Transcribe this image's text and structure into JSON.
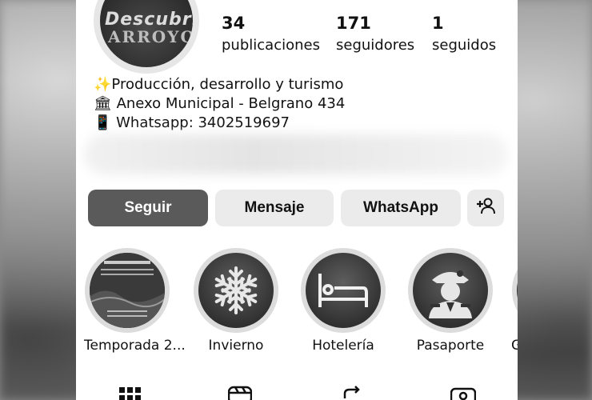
{
  "profile": {
    "avatar_text_1": "Descubrí",
    "avatar_text_2": "ARROYO"
  },
  "stats": [
    {
      "value": "34",
      "label": "publicaciones"
    },
    {
      "value": "171",
      "label": "seguidores"
    },
    {
      "value": "1",
      "label": "seguidos"
    }
  ],
  "bio": {
    "line1": "✨Producción, desarrollo y turismo",
    "line2": "🏛 Anexo Municipal - Belgrano 434",
    "line3": "📱 Whatsapp: 3402519697"
  },
  "actions": {
    "follow": "Seguir",
    "message": "Mensaje",
    "whatsapp": "WhatsApp"
  },
  "highlights": [
    {
      "label": "Temporada 2...",
      "icon": "poster-icon"
    },
    {
      "label": "Invierno",
      "icon": "snowflake-icon"
    },
    {
      "label": "Hotelería",
      "icon": "bed-icon"
    },
    {
      "label": "Pasaporte",
      "icon": "general-portrait-icon"
    },
    {
      "label": "G",
      "icon": "highlight-icon"
    }
  ],
  "colors": {
    "primary_button": "#5a5a5a",
    "secondary_button": "#ebebeb",
    "text": "#111111"
  }
}
